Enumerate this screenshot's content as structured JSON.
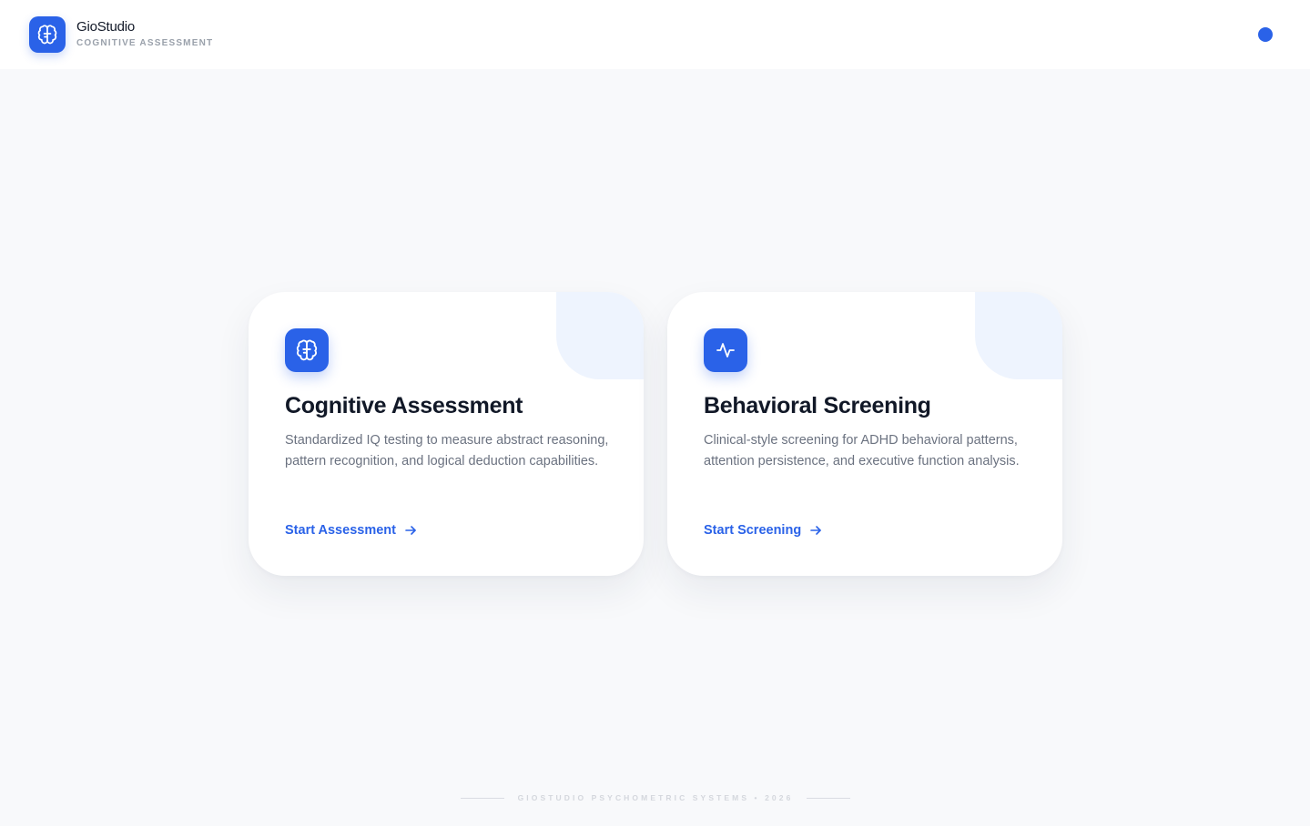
{
  "header": {
    "brand_name": "GioStudio",
    "brand_subtitle": "COGNITIVE ASSESSMENT",
    "logo_icon": "brain-icon",
    "status_indicator_color": "#2a62e8"
  },
  "cards": [
    {
      "icon": "brain-icon",
      "title": "Cognitive Assessment",
      "description": "Standardized IQ testing to measure abstract reasoning, pattern recognition, and logical deduction capabilities.",
      "link_label": "Start Assessment"
    },
    {
      "icon": "activity-pulse-icon",
      "title": "Behavioral Screening",
      "description": "Clinical-style screening for ADHD behavioral patterns, attention persistence, and executive function analysis.",
      "link_label": "Start Screening"
    }
  ],
  "footer": {
    "text": "GIOSTUDIO PSYCHOMETRIC SYSTEMS • 2026"
  },
  "colors": {
    "accent": "#2a62e8",
    "background": "#f8f9fb",
    "card_corner": "#eef4fe",
    "heading": "#111827",
    "body_text": "#6b7280"
  }
}
